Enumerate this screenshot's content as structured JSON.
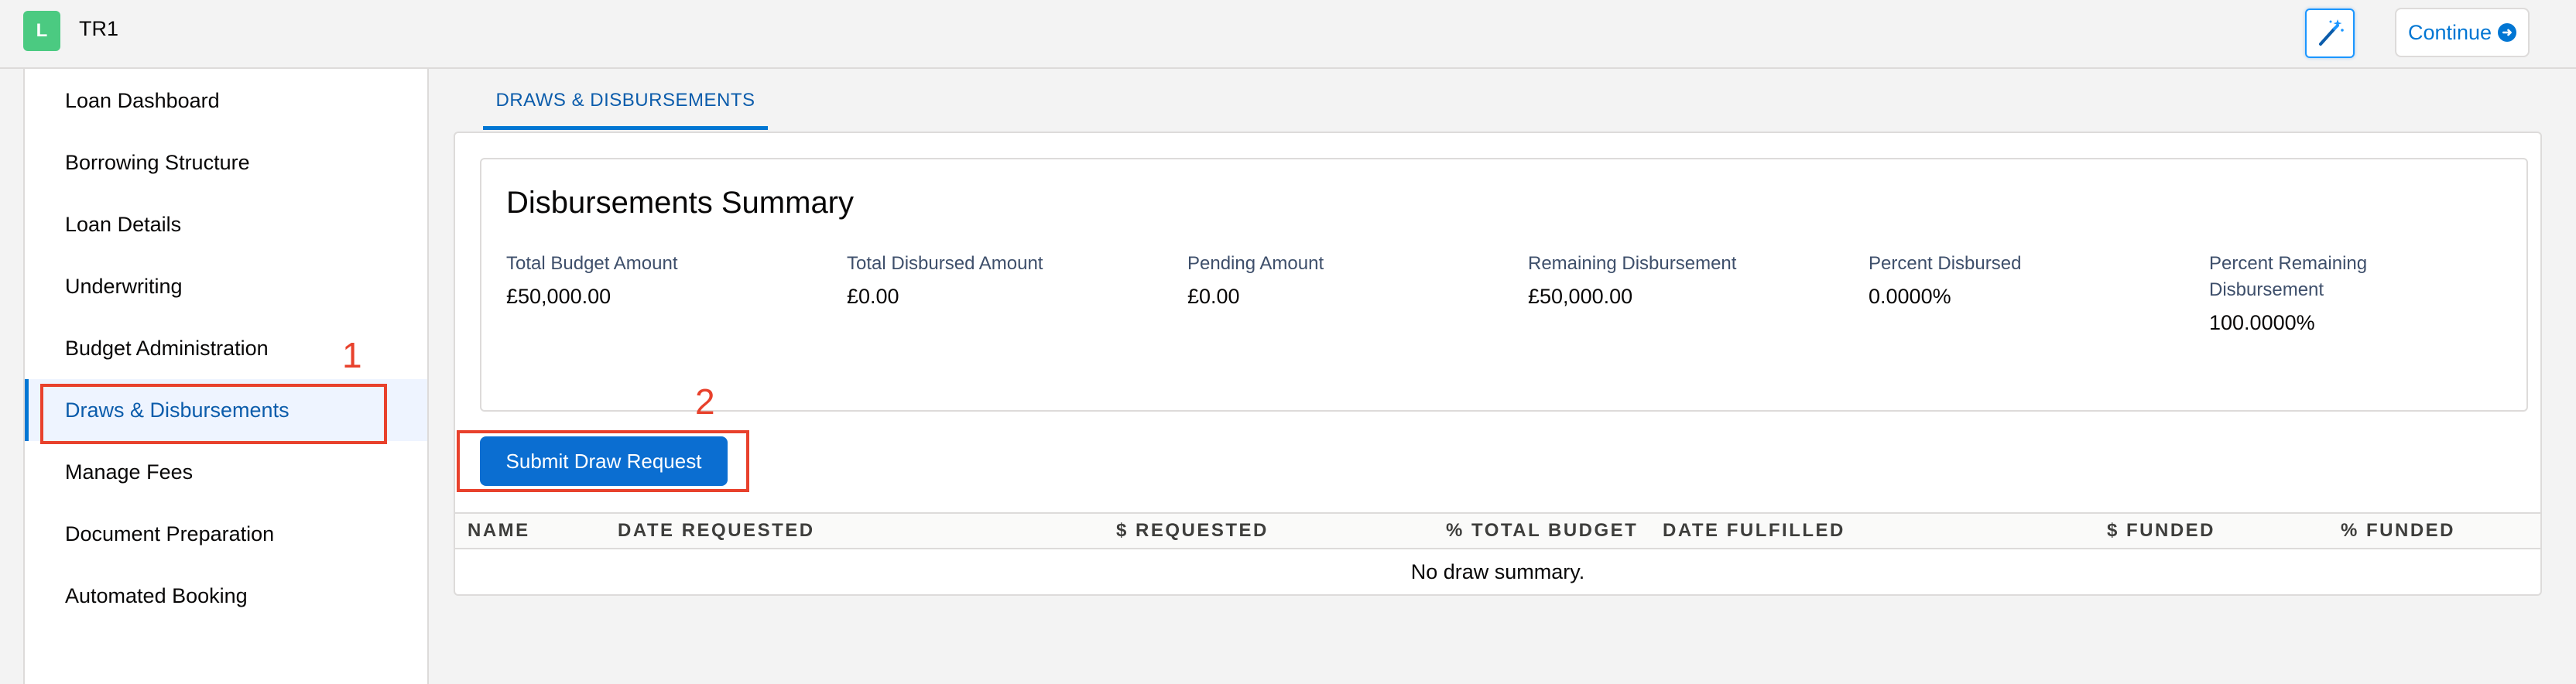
{
  "header": {
    "app_initial": "L",
    "app_title": "TR1",
    "continue_label": "Continue"
  },
  "sidebar": {
    "items": [
      {
        "label": "Loan Dashboard"
      },
      {
        "label": "Borrowing Structure"
      },
      {
        "label": "Loan Details"
      },
      {
        "label": "Underwriting"
      },
      {
        "label": "Budget Administration"
      },
      {
        "label": "Draws & Disbursements",
        "active": true
      },
      {
        "label": "Manage Fees"
      },
      {
        "label": "Document Preparation"
      },
      {
        "label": "Automated Booking"
      }
    ]
  },
  "annotations": {
    "one": "1",
    "two": "2"
  },
  "tab": {
    "label": "DRAWS & DISBURSEMENTS"
  },
  "summary": {
    "title": "Disbursements Summary",
    "metrics": [
      {
        "label": "Total Budget Amount",
        "value": "£50,000.00"
      },
      {
        "label": "Total Disbursed Amount",
        "value": "£0.00"
      },
      {
        "label": "Pending Amount",
        "value": "£0.00"
      },
      {
        "label": "Remaining Disbursement",
        "value": "£50,000.00"
      },
      {
        "label": "Percent Disbursed",
        "value": "0.0000%"
      },
      {
        "label": "Percent Remaining Disbursement",
        "value": "100.0000%"
      }
    ]
  },
  "actions": {
    "submit_label": "Submit Draw Request"
  },
  "table": {
    "columns": [
      "NAME",
      "DATE REQUESTED",
      "$ REQUESTED",
      "% TOTAL BUDGET",
      "DATE FULFILLED",
      "$ FUNDED",
      "% FUNDED"
    ],
    "empty_message": "No draw summary."
  },
  "colors": {
    "brand_blue": "#0176d3",
    "button_blue": "#0b6ed1",
    "annotation_red": "#e8412c",
    "app_badge_green": "#4bca81"
  },
  "icons": {
    "wand": "magic-wand-icon",
    "continue": "arrow-right-circle-icon"
  }
}
